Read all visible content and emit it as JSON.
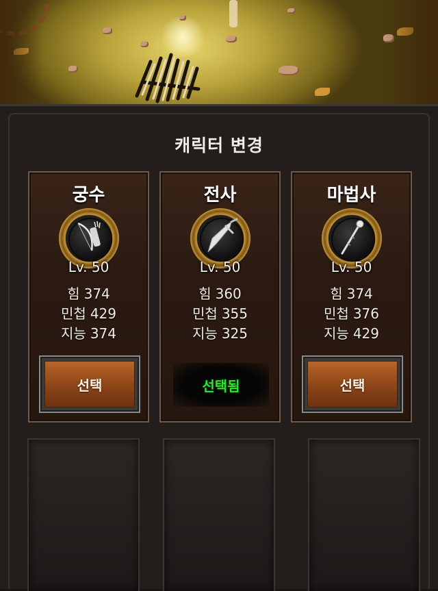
{
  "title": "캐릭터 변경",
  "characters": [
    {
      "name": "궁수",
      "emblem_icon": "bow-and-quiver-icon",
      "level": "Lv. 50",
      "stats": [
        {
          "label": "힘",
          "value": "374"
        },
        {
          "label": "민첩",
          "value": "429"
        },
        {
          "label": "지능",
          "value": "374"
        }
      ],
      "action": "선택",
      "selected": false
    },
    {
      "name": "전사",
      "emblem_icon": "sword-icon",
      "level": "Lv. 50",
      "stats": [
        {
          "label": "힘",
          "value": "360"
        },
        {
          "label": "민첩",
          "value": "355"
        },
        {
          "label": "지능",
          "value": "325"
        }
      ],
      "action": "선택됨",
      "selected": true
    },
    {
      "name": "마법사",
      "emblem_icon": "staff-icon",
      "level": "Lv. 50",
      "stats": [
        {
          "label": "힘",
          "value": "374"
        },
        {
          "label": "민첩",
          "value": "376"
        },
        {
          "label": "지능",
          "value": "429"
        }
      ],
      "action": "선택",
      "selected": false
    }
  ],
  "colors": {
    "selected_text": "#2ee62e",
    "button_wood": "#8f4718",
    "emblem_gold": "#c99632"
  }
}
